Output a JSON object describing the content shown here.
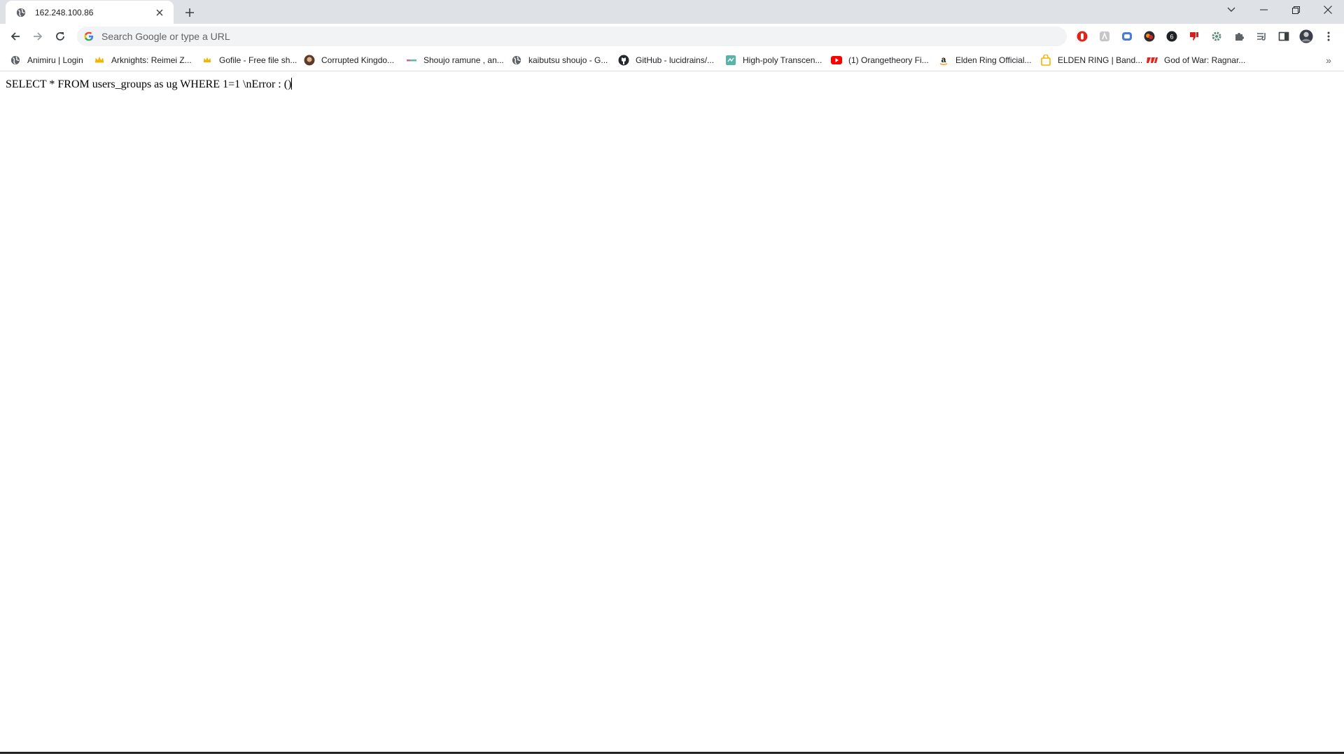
{
  "tab": {
    "title": "162.248.100.86"
  },
  "omnibox": {
    "placeholder": "Search Google or type a URL"
  },
  "bookmarks": [
    {
      "label": "Animiru | Login",
      "icon": "globe-icon"
    },
    {
      "label": "Arknights: Reimei Z...",
      "icon": "crown-icon"
    },
    {
      "label": "Gofile - Free file sh...",
      "icon": "crown-icon"
    },
    {
      "label": "Corrupted Kingdo...",
      "icon": "avatar-icon"
    },
    {
      "label": "Shoujo ramune , an...",
      "icon": "bar-icon"
    },
    {
      "label": "kaibutsu shoujo - G...",
      "icon": "globe-icon"
    },
    {
      "label": "GitHub - lucidrains/...",
      "icon": "github-icon"
    },
    {
      "label": "High-poly Transcen...",
      "icon": "tile-icon"
    },
    {
      "label": "(1) Orangetheory Fi...",
      "icon": "youtube-icon"
    },
    {
      "label": "Elden Ring Official...",
      "icon": "amazon-icon"
    },
    {
      "label": "ELDEN RING | Band...",
      "icon": "bag-icon"
    },
    {
      "label": "God of War: Ragnar...",
      "icon": "gow-icon"
    }
  ],
  "content": {
    "text": "SELECT * FROM users_groups as ug WHERE 1=1 \\nError : ()"
  },
  "colors": {
    "tabstrip": "#dee1e6",
    "omnibox": "#f1f3f4",
    "icon": "#5f6368"
  }
}
